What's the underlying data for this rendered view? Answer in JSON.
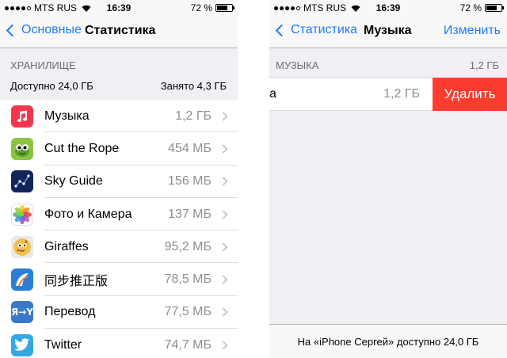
{
  "left": {
    "status": {
      "carrier": "MTS RUS",
      "time": "16:39",
      "battery": "72 %",
      "battery_level": 0.72
    },
    "nav": {
      "back_label": "Основные",
      "title": "Статистика"
    },
    "storage": {
      "header": "ХРАНИЛИЩЕ",
      "available": "Доступно 24,0 ГБ",
      "used": "Занято 4,3 ГБ"
    },
    "apps": [
      {
        "name": "Музыка",
        "size": "1,2 ГБ",
        "icon": "music-icon",
        "color": "#f4364c"
      },
      {
        "name": "Cut the Rope",
        "size": "454 МБ",
        "icon": "cut-the-rope-icon",
        "color": "#8bc53f"
      },
      {
        "name": "Sky Guide",
        "size": "156 МБ",
        "icon": "sky-guide-icon",
        "color": "#13245a"
      },
      {
        "name": "Фото и Камера",
        "size": "137 МБ",
        "icon": "photos-icon",
        "color": "#ffffff"
      },
      {
        "name": "Giraffes",
        "size": "95,2 МБ",
        "icon": "giraffes-icon",
        "color": "#f2c14e"
      },
      {
        "name": "同步推正版",
        "size": "78,5 МБ",
        "icon": "tongbutui-icon",
        "color": "#2a7fd4"
      },
      {
        "name": "Перевод",
        "size": "77,5 МБ",
        "icon": "translate-icon",
        "color": "#3a79c9"
      },
      {
        "name": "Twitter",
        "size": "74,7 МБ",
        "icon": "twitter-icon",
        "color": "#34a8e6"
      }
    ]
  },
  "right": {
    "status": {
      "carrier": "MTS RUS",
      "time": "16:39",
      "battery": "72 %",
      "battery_level": 0.72
    },
    "nav": {
      "back_label": "Статистика",
      "title": "Музыка",
      "edit_label": "Изменить"
    },
    "section": {
      "header": "МУЗЫКА",
      "size": "1,2 ГБ"
    },
    "row": {
      "partial_label": "а",
      "size": "1,2 ГБ"
    },
    "delete_label": "Удалить",
    "footer": "На «iPhone Сергей» доступно 24,0 ГБ"
  }
}
